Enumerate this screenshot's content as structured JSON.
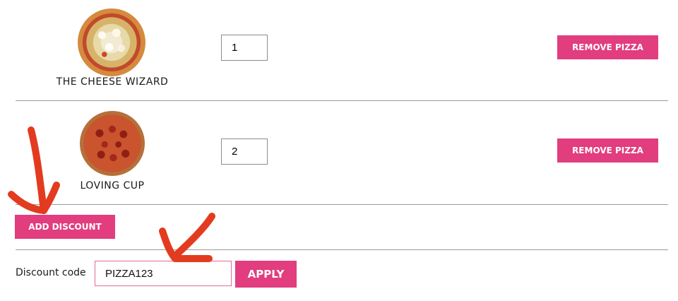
{
  "cart": {
    "items": [
      {
        "name": "THE CHEESE WIZARD",
        "quantity": "1",
        "remove_label": "REMOVE PIZZA",
        "image_icon": "cheese-pizza"
      },
      {
        "name": "LOVING CUP",
        "quantity": "2",
        "remove_label": "REMOVE PIZZA",
        "image_icon": "pepperoni-pizza"
      }
    ]
  },
  "discount": {
    "add_label": "ADD DISCOUNT",
    "field_label": "Discount code",
    "code_value": "PIZZA123",
    "apply_label": "APPLY"
  },
  "colors": {
    "accent": "#e23d7e",
    "annotation_arrow": "#e33b1f",
    "divider": "#9a9a9a"
  }
}
